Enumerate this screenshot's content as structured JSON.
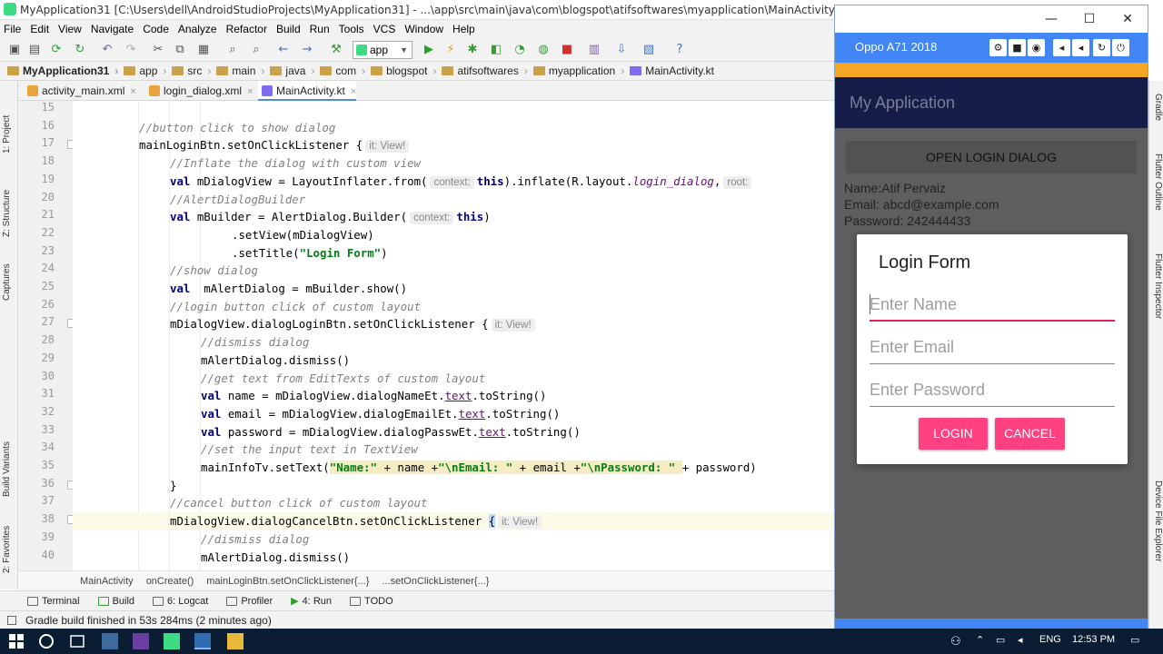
{
  "window": {
    "title": "MyApplication31 [C:\\Users\\dell\\AndroidStudioProjects\\MyApplication31] - ...\\app\\src\\main\\java\\com\\blogspot\\atifsoftwares\\myapplication\\MainActivity.kt [app] - Android Studio"
  },
  "menu": [
    "File",
    "Edit",
    "View",
    "Navigate",
    "Code",
    "Analyze",
    "Refactor",
    "Build",
    "Run",
    "Tools",
    "VCS",
    "Window",
    "Help"
  ],
  "toolbar": {
    "run_config": "app"
  },
  "breadcrumbs": [
    "MyApplication31",
    "app",
    "src",
    "main",
    "java",
    "com",
    "blogspot",
    "atifsoftwares",
    "myapplication",
    "MainActivity.kt"
  ],
  "left_tabs": [
    "1: Project",
    "Z: Structure",
    "Captures",
    "Build Variants",
    "2: Favorites"
  ],
  "right_tabs": [
    "Gradle",
    "Flutter Outline",
    "Flutter Inspector",
    "Device File Explorer"
  ],
  "editor_tabs": [
    {
      "label": "activity_main.xml",
      "color": "#e8a33d"
    },
    {
      "label": "login_dialog.xml",
      "color": "#e8a33d"
    },
    {
      "label": "MainActivity.kt",
      "color": "#7f6cf0"
    }
  ],
  "code": {
    "line_numbers": [
      "15",
      "16",
      "17",
      "18",
      "19",
      "20",
      "21",
      "22",
      "23",
      "24",
      "25",
      "26",
      "27",
      "28",
      "29",
      "30",
      "31",
      "32",
      "33",
      "34",
      "35",
      "36",
      "37",
      "38",
      "39",
      "40"
    ],
    "lines": {
      "l16": "//button click to show dialog",
      "l17a": "mainLoginBtn.setOnClickListener {",
      "l17h": "it: View!",
      "l18": "//Inflate the dialog with custom view",
      "l19a": "val",
      "l19b": " mDialogView = LayoutInflater.from(",
      "l19h": "context:",
      "l19c": "this",
      "l19d": ").inflate(R.layout.",
      "l19e": "login_dialog",
      "l19f": ",",
      "l19h2": "root:",
      "l20": "//AlertDialogBuilder",
      "l21a": "val",
      "l21b": " mBuilder = AlertDialog.Builder(",
      "l21h": "context:",
      "l21c": "this",
      "l21d": ")",
      "l22": ".setView(mDialogView)",
      "l23a": ".setTitle(",
      "l23b": "\"Login Form\"",
      "l23c": ")",
      "l24": "//show dialog",
      "l25a": "val",
      "l25b": "  mAlertDialog = mBuilder.show()",
      "l26": "//login button click of custom layout",
      "l27a": "mDialogView.dialogLoginBtn.setOnClickListener {",
      "l27h": "it: View!",
      "l28": "//dismiss dialog",
      "l29": "mAlertDialog.dismiss()",
      "l30": "//get text from EditTexts of custom layout",
      "l31a": "val",
      "l31b": " name = mDialogView.dialogNameEt.",
      "l31c": "text",
      "l31d": ".toString()",
      "l32a": "val",
      "l32b": " email = mDialogView.dialogEmailEt.",
      "l32c": "text",
      "l32d": ".toString()",
      "l33a": "val",
      "l33b": " password = mDialogView.dialogPasswEt.",
      "l33c": "text",
      "l33d": ".toString()",
      "l34": "//set the input text in TextView",
      "l35a": "mainInfoTv.setText(",
      "l35b": "\"Name:\"",
      "l35c": "+ name +",
      "l35d": "\"\\nEmail: \"",
      "l35e": "+ email +",
      "l35f": "\"\\nPassword: \"",
      "l35g": "+ password)",
      "l36": "}",
      "l37": "//cancel button click of custom layout",
      "l38a": "mDialogView.dialogCancelBtn.setOnClickListener ",
      "l38b": "{",
      "l38h": "it: View!",
      "l39": "//dismiss dialog",
      "l40": "mAlertDialog.dismiss()"
    }
  },
  "editor_breadcrumb": [
    "MainActivity",
    "onCreate()",
    "mainLoginBtn.setOnClickListener{...}",
    "...setOnClickListener{...}"
  ],
  "bottom_tools": [
    "Terminal",
    "Build",
    "6: Logcat",
    "Profiler",
    "4: Run",
    "TODO"
  ],
  "status": {
    "message": "Gradle build finished in 53s 284ms (2 minutes ago)"
  },
  "emulator": {
    "device": "Oppo A71 2018",
    "app_title": "My Application",
    "open_button": "OPEN LOGIN DIALOG",
    "info_lines": [
      "Name:Atif Pervaiz",
      "Email: abcd@example.com",
      "Password: 242444433"
    ],
    "dialog": {
      "title": "Login Form",
      "name_hint": "Enter Name",
      "email_hint": "Enter Email",
      "password_hint": "Enter Password",
      "login": "LOGIN",
      "cancel": "CANCEL"
    }
  },
  "taskbar": {
    "lang": "ENG",
    "time": "12:53 PM"
  },
  "colors": {
    "accent": "#ff4081",
    "emulator_bar": "#4285f4",
    "app_bar": "#161d49",
    "status_strip": "#f5a623"
  }
}
